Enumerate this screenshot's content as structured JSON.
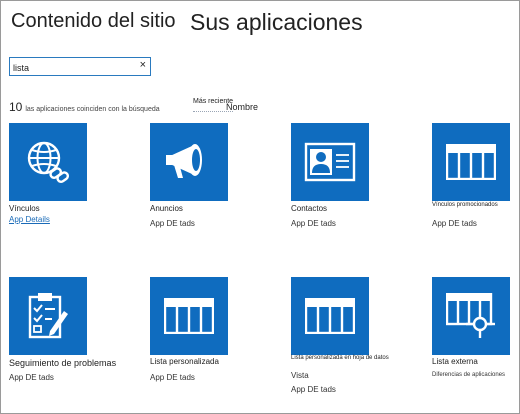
{
  "header": {
    "site_title": "Contenido del sitio",
    "page_title": "Sus aplicaciones"
  },
  "search": {
    "value": "lista",
    "clear_symbol": "×"
  },
  "results": {
    "count": "10",
    "text": "las aplicaciones coinciden con la búsqueda"
  },
  "sort": {
    "recent": "Más reciente",
    "name": "Nombre"
  },
  "colors": {
    "tile_blue": "#0f6cbf",
    "link_blue": "#1a6bb8"
  },
  "apps": [
    {
      "name": "Vínculos",
      "sub": "App Details",
      "icon": "globe-link-icon"
    },
    {
      "name": "Anuncios",
      "sub": "App DE tads",
      "icon": "megaphone-icon"
    },
    {
      "name": "Contactos",
      "sub": "App DE tads",
      "icon": "contact-card-icon"
    },
    {
      "name": "Vínculos promocionados",
      "sub": "App DE tads",
      "icon": "list-grid-icon"
    },
    {
      "name": "Seguimiento de problemas",
      "sub": "App DE tads",
      "icon": "clipboard-checklist-icon"
    },
    {
      "name": "Lista personalizada",
      "sub": "App DE tads",
      "icon": "list-grid-icon"
    },
    {
      "name": "Lista personalizada en hoja de datos",
      "sub": "Vista",
      "sub2": "App DE tads",
      "icon": "list-grid-icon"
    },
    {
      "name": "Lista externa",
      "sub": "Diferencias de aplicaciones",
      "icon": "external-list-icon"
    }
  ]
}
